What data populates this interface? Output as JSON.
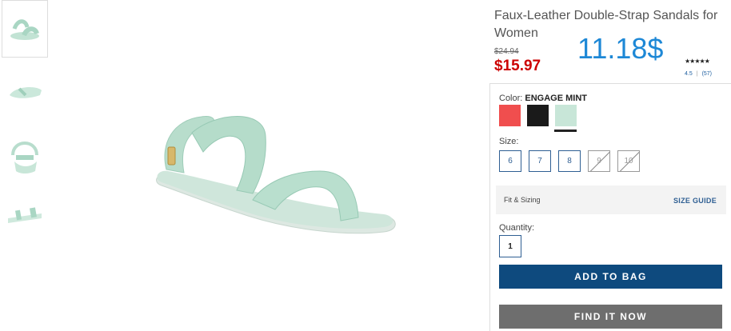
{
  "product": {
    "title": "Faux-Leather Double-Strap Sandals for Women",
    "was_price": "$24.94",
    "now_price": "$15.97",
    "big_price": "11.18$",
    "rating_stars": "★★★★★",
    "rating_value": "4.5",
    "rating_count": "(57)"
  },
  "thumbnails": [
    {
      "name": "thumb-side-view"
    },
    {
      "name": "thumb-front-view"
    },
    {
      "name": "thumb-back-view"
    },
    {
      "name": "thumb-top-view"
    }
  ],
  "color": {
    "label": "Color:",
    "selected": "ENGAGE MINT",
    "swatches": [
      {
        "name": "coral",
        "hex": "#f04e4e"
      },
      {
        "name": "black",
        "hex": "#1a1a1a"
      },
      {
        "name": "engage-mint",
        "hex": "#c8e6d8"
      }
    ]
  },
  "size": {
    "label": "Size:",
    "options": [
      {
        "label": "6",
        "available": true
      },
      {
        "label": "7",
        "available": true
      },
      {
        "label": "8",
        "available": true
      },
      {
        "label": "9",
        "available": false
      },
      {
        "label": "10",
        "available": false
      }
    ]
  },
  "fit": {
    "label": "Fit & Sizing",
    "guide": "SIZE GUIDE"
  },
  "quantity": {
    "label": "Quantity:",
    "value": "1"
  },
  "buttons": {
    "add_to_bag": "ADD TO BAG",
    "find_it_now": "FIND IT NOW"
  }
}
